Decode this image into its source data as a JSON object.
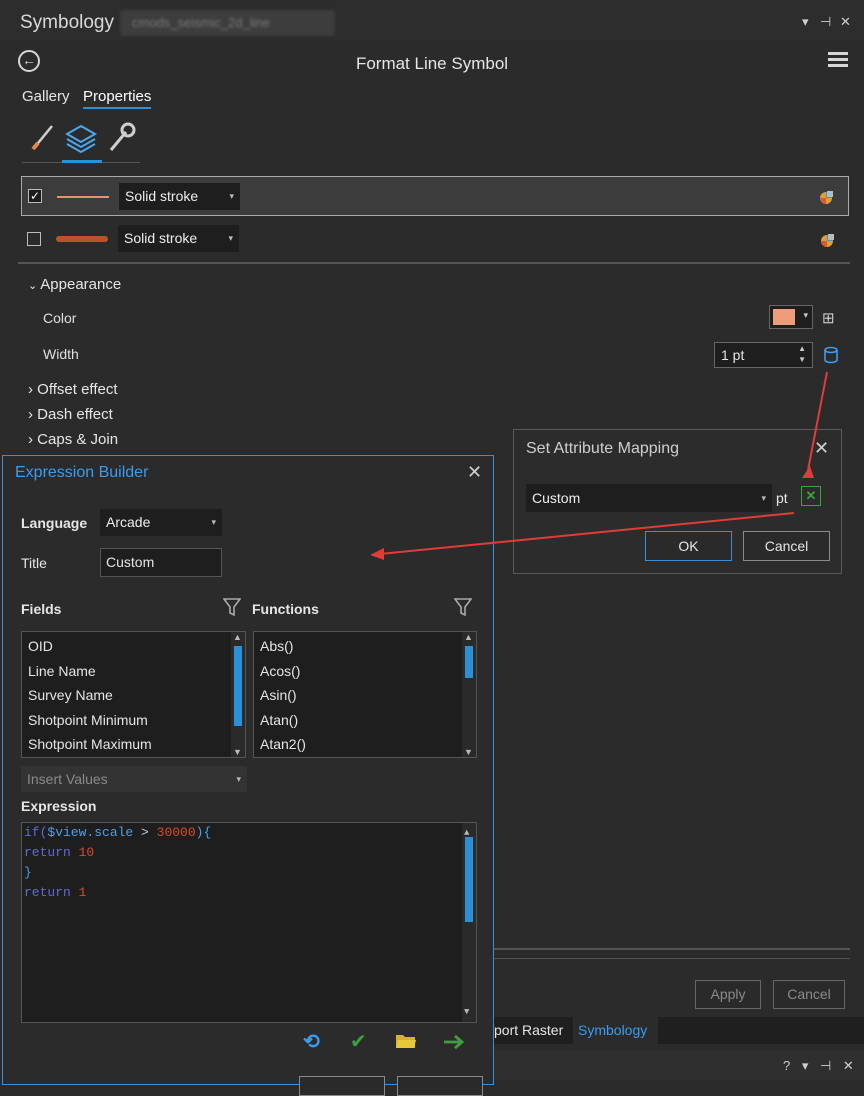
{
  "pane": {
    "title": "Symbology",
    "layer_name": "cmods_seismic_2d_line",
    "controls": [
      "▾",
      "⊣",
      "✕"
    ],
    "subtitle": "Format Line Symbol",
    "tabs": [
      "Gallery",
      "Properties"
    ],
    "active_tab": "Properties",
    "layers": [
      {
        "checked": true,
        "stroke": "Solid stroke",
        "color": "#e6936e"
      },
      {
        "checked": false,
        "stroke": "Solid stroke",
        "color": "#b8532c"
      }
    ],
    "appearance": {
      "section": "Appearance",
      "color_label": "Color",
      "color_value": "#ee9d7a",
      "width_label": "Width",
      "width_value": "1 pt"
    },
    "sections": [
      "Offset effect",
      "Dash effect",
      "Caps & Join"
    ],
    "bottom_buttons": {
      "apply": "Apply",
      "cancel": "Cancel"
    },
    "bottom_tabs": [
      "port Raster",
      "Symbology"
    ],
    "bottom_controls": "? ▾ ⊣ ✕"
  },
  "attribute_mapping": {
    "title": "Set Attribute Mapping",
    "value": "Custom",
    "unit": "pt",
    "ok": "OK",
    "cancel": "Cancel"
  },
  "expression_builder": {
    "title": "Expression Builder",
    "language_label": "Language",
    "language_value": "Arcade",
    "title_label": "Title",
    "title_value": "Custom",
    "fields_label": "Fields",
    "functions_label": "Functions",
    "fields": [
      "OID",
      "Line Name",
      "Survey Name",
      "Shotpoint Minimum",
      "Shotpoint Maximum"
    ],
    "functions": [
      "Abs()",
      "Acos()",
      "Asin()",
      "Atan()",
      "Atan2()"
    ],
    "insert_values": "Insert Values",
    "expression_label": "Expression",
    "expression": {
      "l1_if": "if(",
      "l1_var": "$view.scale",
      "l1_op": " > ",
      "l1_num": "30000",
      "l1_end": "){",
      "l2_kw": "return ",
      "l2_num": "10",
      "l3": "}",
      "l4_kw": "return ",
      "l4_num": "1"
    }
  }
}
